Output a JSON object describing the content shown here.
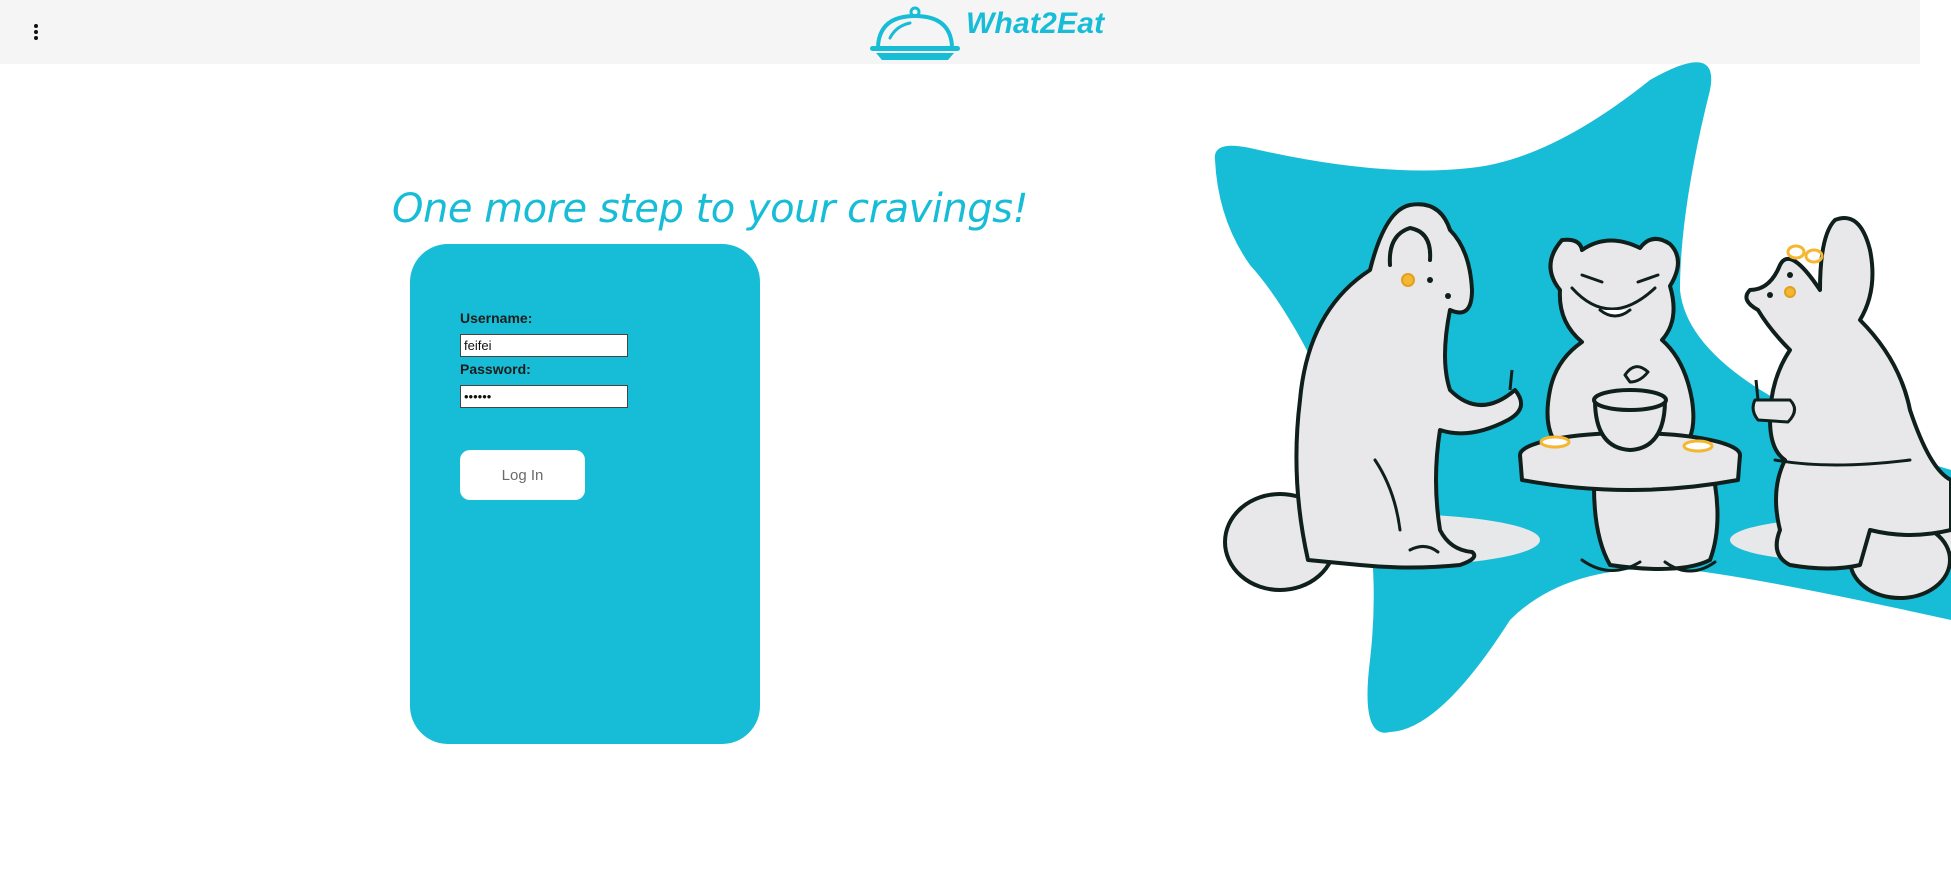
{
  "app": {
    "name": "What2Eat",
    "brand_color": "#17bdd6"
  },
  "header": {
    "menu_icon": "more-vert-icon",
    "logo_icon": "food-cloche-icon",
    "brand_text": "What2Eat"
  },
  "main": {
    "headline": "One more step to your cravings!"
  },
  "login_form": {
    "username_label": "Username:",
    "username_value": "feifei",
    "password_label": "Password:",
    "password_value": "••••••",
    "login_label": "Log In"
  },
  "illustration": {
    "icon": "bears-tea-party-illustration",
    "background_color": "#17bdd6",
    "accent_color": "#f5b731"
  }
}
